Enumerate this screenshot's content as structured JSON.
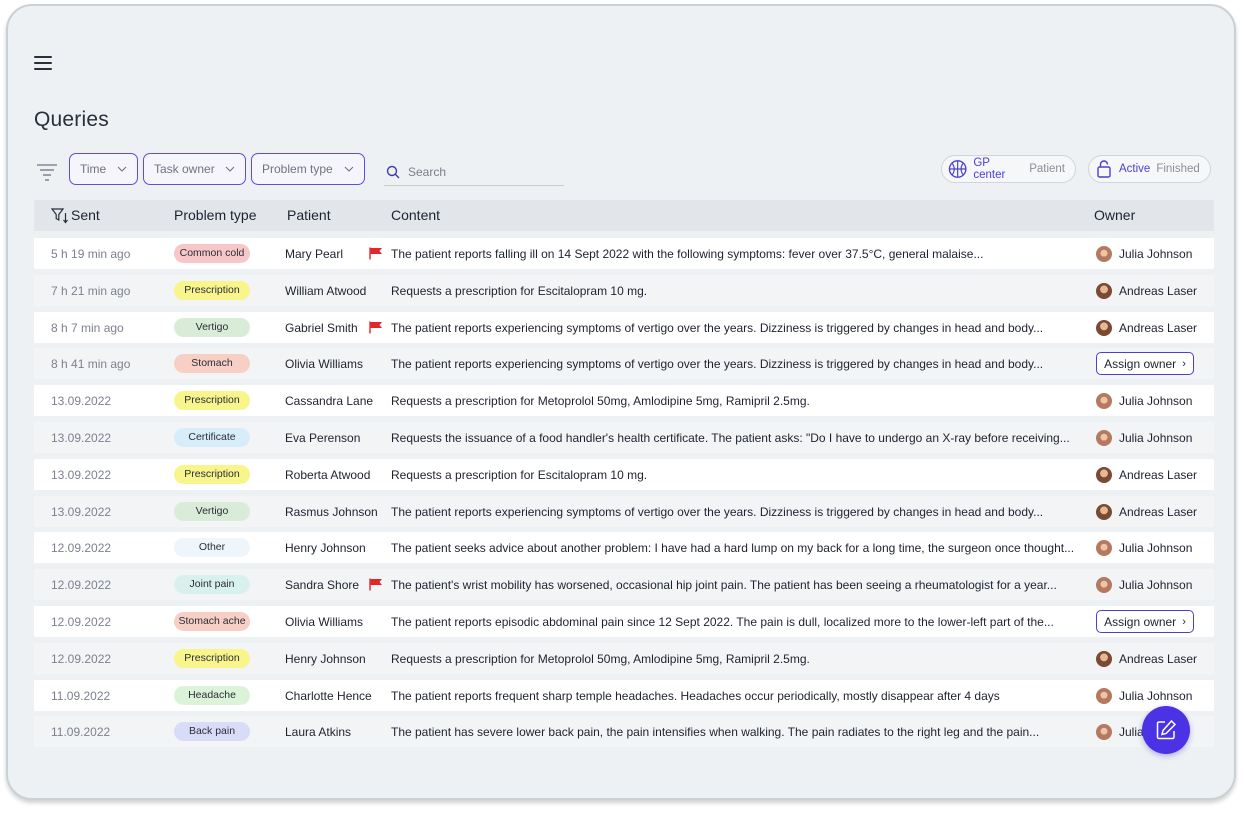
{
  "page": {
    "title": "Queries"
  },
  "filters": {
    "time_label": "Time",
    "task_owner_label": "Task owner",
    "problem_type_label": "Problem type",
    "search_placeholder": "Search"
  },
  "toggles": {
    "center": {
      "selected": "GP center",
      "other": "Patient"
    },
    "status": {
      "selected": "Active",
      "other": "Finished"
    }
  },
  "table": {
    "headers": {
      "sent": "Sent",
      "problem_type": "Problem type",
      "patient": "Patient",
      "content": "Content",
      "owner": "Owner"
    },
    "assign_label": "Assign owner",
    "rows": [
      {
        "sent": "5 h 19 min ago",
        "type": "Common cold",
        "patient": "Mary Pearl",
        "flag": true,
        "content": "The patient reports falling ill on 14 Sept 2022 with the following symptoms: fever over 37.5°C, general malaise...",
        "owner": "Julia Johnson"
      },
      {
        "sent": "7 h 21 min  ago",
        "type": "Prescription",
        "patient": "William Atwood",
        "flag": false,
        "content": "Requests a prescription for Escitalopram 10 mg.",
        "owner": "Andreas Laser"
      },
      {
        "sent": "8 h 7 min  ago",
        "type": "Vertigo",
        "patient": "Gabriel Smith",
        "flag": true,
        "content": "The patient reports experiencing symptoms of vertigo over the years. Dizziness is triggered by changes in head and body...",
        "owner": "Andreas Laser"
      },
      {
        "sent": "8 h 41 min  ago",
        "type": "Stomach",
        "patient": "Olivia Williams",
        "flag": false,
        "content": "The patient reports experiencing symptoms of vertigo over the years. Dizziness is triggered by changes in head and body...",
        "owner": ""
      },
      {
        "sent": "13.09.2022",
        "type": "Prescription",
        "patient": "Cassandra Lane",
        "flag": false,
        "content": "Requests a prescription for Metoprolol 50mg, Amlodipine 5mg, Ramipril 2.5mg.",
        "owner": "Julia Johnson"
      },
      {
        "sent": "13.09.2022",
        "type": "Certificate",
        "patient": "Eva Perenson",
        "flag": false,
        "content": "Requests the issuance of a food handler's health certificate. The patient asks: \"Do I have to undergo an X-ray before receiving...",
        "owner": "Julia Johnson"
      },
      {
        "sent": "13.09.2022",
        "type": "Prescription",
        "patient": "Roberta Atwood",
        "flag": false,
        "content": "Requests a prescription for Escitalopram 10 mg.",
        "owner": "Andreas Laser"
      },
      {
        "sent": "13.09.2022",
        "type": "Vertigo",
        "patient": "Rasmus Johnson",
        "flag": false,
        "content": "The patient reports experiencing symptoms of vertigo over the years. Dizziness is triggered by changes in head and body...",
        "owner": "Andreas Laser"
      },
      {
        "sent": "12.09.2022",
        "type": "Other",
        "patient": "Henry Johnson",
        "flag": false,
        "content": "The patient seeks advice about another problem: I have had a hard lump on my back for a long time, the surgeon once thought...",
        "owner": "Julia Johnson"
      },
      {
        "sent": "12.09.2022",
        "type": "Joint pain",
        "patient": "Sandra Shore",
        "flag": true,
        "content": "The patient's wrist mobility has worsened, occasional hip joint pain. The patient has been seeing a rheumatologist for a year...",
        "owner": "Julia Johnson"
      },
      {
        "sent": "12.09.2022",
        "type": "Stomach ache",
        "patient": "Olivia Williams",
        "flag": false,
        "content": "The patient reports episodic abdominal pain since 12 Sept 2022. The pain is dull, localized more to the lower-left part of the...",
        "owner": ""
      },
      {
        "sent": "12.09.2022",
        "type": "Prescription",
        "patient": "Henry Johnson",
        "flag": false,
        "content": "Requests a prescription for Metoprolol 50mg, Amlodipine 5mg, Ramipril 2.5mg.",
        "owner": "Andreas Laser"
      },
      {
        "sent": "11.09.2022",
        "type": "Headache",
        "patient": "Charlotte Hence",
        "flag": false,
        "content": "The patient reports frequent sharp temple headaches. Headaches occur periodically, mostly disappear after 4 days",
        "owner": "Julia Johnson"
      },
      {
        "sent": "11.09.2022",
        "type": "Back pain",
        "patient": "Laura Atkins",
        "flag": false,
        "content": "The patient has severe lower back pain, the pain intensifies when walking. The pain radiates to the right leg and the pain...",
        "owner": "Julia"
      }
    ]
  },
  "colors": {
    "accent": "#4a3fd0",
    "fab": "#4b32e4",
    "flag": "#e3262e",
    "badge_common_cold": "#f6c7c6",
    "badge_prescription": "#f8f58c",
    "badge_vertigo": "#d8ecd7",
    "badge_stomach": "#f7cfc4",
    "badge_certificate": "#d7eefa",
    "badge_other": "#eef6fc",
    "badge_joint_pain": "#d9f1ec",
    "badge_headache": "#dcf2d9",
    "badge_back_pain": "#d9dcf7"
  },
  "icons": {
    "menu": "hamburger-icon",
    "filter": "filter-lines-icon",
    "search": "search-icon",
    "center": "basketball-icon",
    "status": "lock-icon",
    "flag": "flag-icon",
    "fab": "edit-icon",
    "sort": "filter-sort-icon"
  }
}
